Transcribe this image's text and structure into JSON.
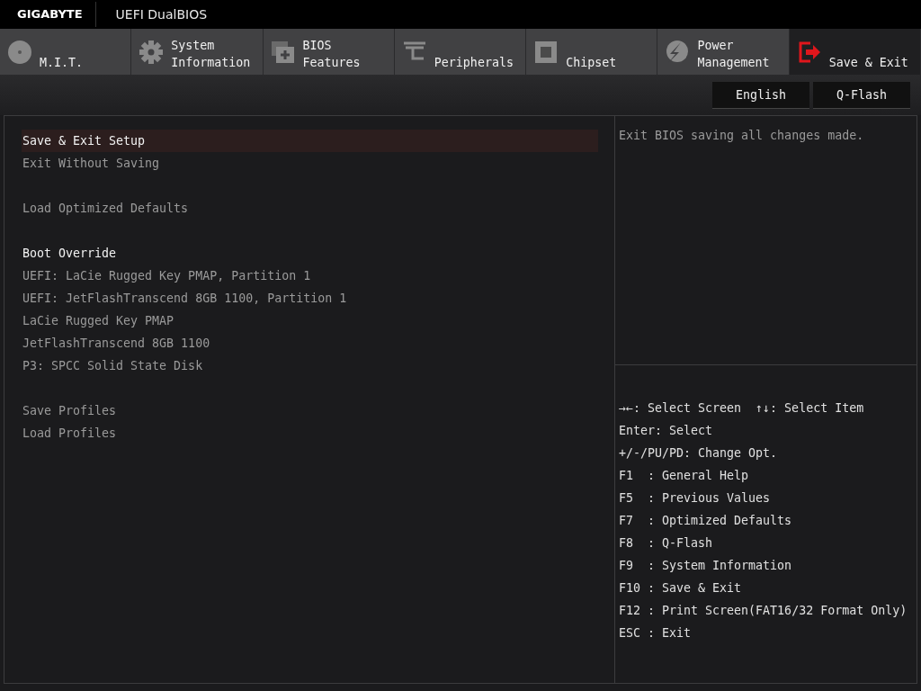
{
  "header": {
    "brand": "GIGABYTE",
    "title": "UEFI DualBIOS"
  },
  "tabs": [
    {
      "kind": "disc",
      "lines": [
        "M.I.T."
      ],
      "selected": false
    },
    {
      "kind": "gear",
      "lines": [
        "System",
        "Information"
      ],
      "selected": false
    },
    {
      "kind": "board",
      "lines": [
        "BIOS",
        "Features"
      ],
      "selected": false
    },
    {
      "kind": "plug",
      "lines": [
        "Peripherals"
      ],
      "selected": false
    },
    {
      "kind": "chip",
      "lines": [
        "Chipset"
      ],
      "selected": false
    },
    {
      "kind": "bolt",
      "lines": [
        "Power",
        "Management"
      ],
      "selected": false
    },
    {
      "kind": "exit",
      "lines": [
        "Save & Exit"
      ],
      "selected": true
    }
  ],
  "toolbar": [
    "English",
    "Q-Flash"
  ],
  "menu": [
    [
      {
        "kind": "item",
        "label": "Save & Exit Setup",
        "selected": true
      },
      {
        "kind": "item",
        "label": "Exit Without Saving",
        "selected": false
      }
    ],
    [
      {
        "kind": "item",
        "label": "Load Optimized Defaults",
        "selected": false
      }
    ],
    [
      {
        "kind": "heading",
        "label": "Boot Override",
        "selected": false
      },
      {
        "kind": "item",
        "label": "UEFI: LaCie Rugged Key PMAP, Partition 1",
        "selected": false
      },
      {
        "kind": "item",
        "label": "UEFI: JetFlashTranscend 8GB 1100, Partition 1",
        "selected": false
      },
      {
        "kind": "item",
        "label": "LaCie Rugged Key PMAP",
        "selected": false
      },
      {
        "kind": "item",
        "label": "JetFlashTranscend 8GB 1100",
        "selected": false
      },
      {
        "kind": "item",
        "label": "P3: SPCC Solid State Disk",
        "selected": false
      }
    ],
    [
      {
        "kind": "item",
        "label": "Save Profiles",
        "selected": false
      },
      {
        "kind": "item",
        "label": "Load Profiles",
        "selected": false
      }
    ]
  ],
  "description": "Exit BIOS saving all changes made.",
  "help": [
    [
      "→←: Select Screen",
      "↑↓: Select Item"
    ],
    [
      "Enter: Select"
    ],
    [
      "+/-/PU/PD: Change Opt."
    ],
    [
      "F1  : General Help"
    ],
    [
      "F5  : Previous Values"
    ],
    [
      "F7  : Optimized Defaults"
    ],
    [
      "F8  : Q-Flash"
    ],
    [
      "F9  : System Information"
    ],
    [
      "F10 : Save & Exit"
    ],
    [
      "F12 : Print Screen(FAT16/32 Format Only)"
    ],
    [
      "ESC : Exit"
    ]
  ]
}
